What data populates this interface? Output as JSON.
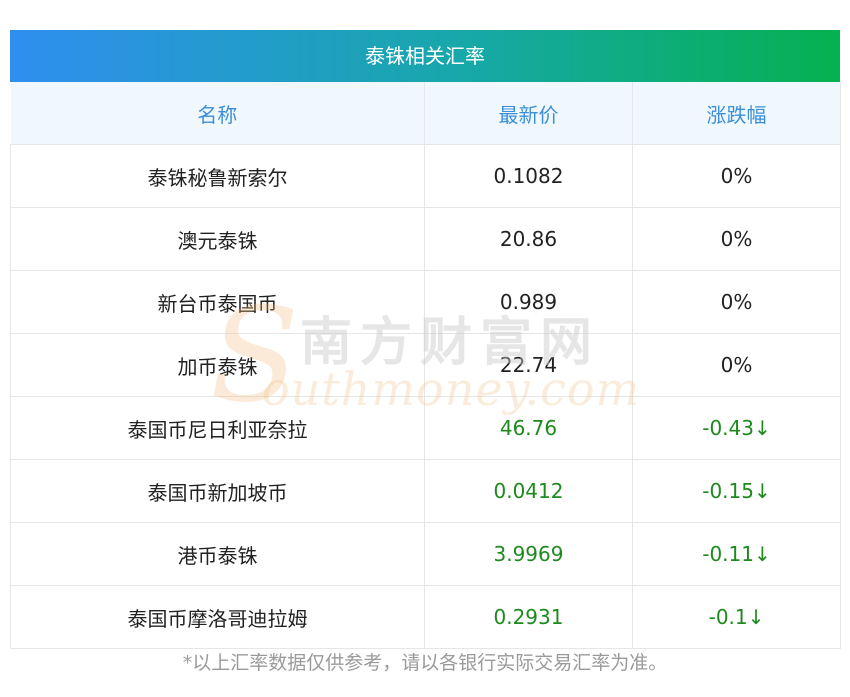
{
  "table": {
    "title": "泰铢相关汇率",
    "headers": [
      "名称",
      "最新价",
      "涨跌幅"
    ],
    "rows": [
      {
        "name": "泰铢秘鲁新索尔",
        "price": "0.1082",
        "change": "0%",
        "trend": "flat"
      },
      {
        "name": "澳元泰铢",
        "price": "20.86",
        "change": "0%",
        "trend": "flat"
      },
      {
        "name": "新台币泰国币",
        "price": "0.989",
        "change": "0%",
        "trend": "flat"
      },
      {
        "name": "加币泰铢",
        "price": "22.74",
        "change": "0%",
        "trend": "flat"
      },
      {
        "name": "泰国币尼日利亚奈拉",
        "price": "46.76",
        "change": "-0.43↓",
        "trend": "down"
      },
      {
        "name": "泰国币新加坡币",
        "price": "0.0412",
        "change": "-0.15↓",
        "trend": "down"
      },
      {
        "name": "港币泰铢",
        "price": "3.9969",
        "change": "-0.11↓",
        "trend": "down"
      },
      {
        "name": "泰国币摩洛哥迪拉姆",
        "price": "0.2931",
        "change": "-0.1↓",
        "trend": "down"
      }
    ]
  },
  "footnote": "*以上汇率数据仅供参考，请以各银行实际交易汇率为准。",
  "watermark": {
    "cn": "南方财富网",
    "en": "outhmoney.com",
    "s": "S"
  },
  "colors": {
    "header_text": "#3b8fd9",
    "down": "#1e8a1e",
    "gradient_start": "#2f8ef0",
    "gradient_end": "#05b14f"
  }
}
